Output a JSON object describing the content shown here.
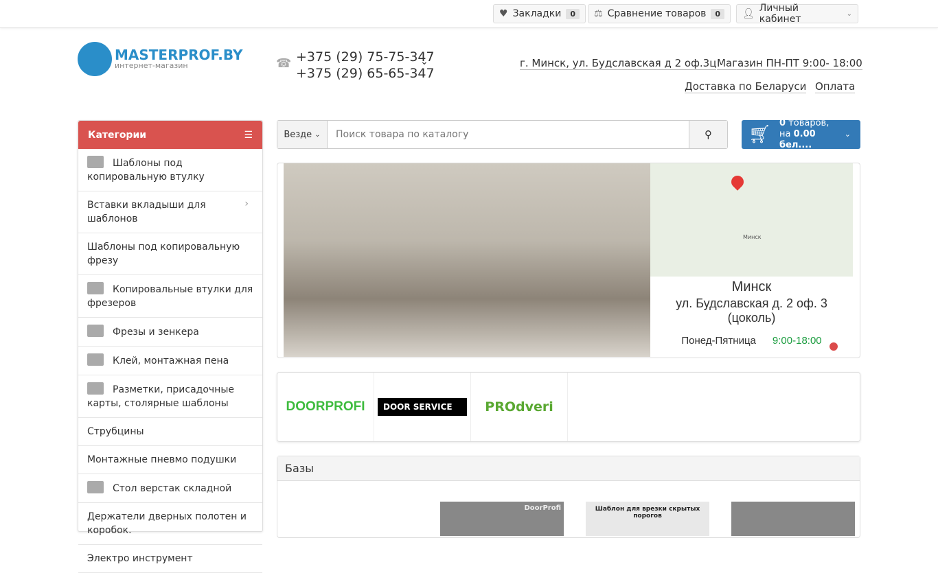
{
  "topbar": {
    "bookmarks": "Закладки",
    "bookmarks_count": "0",
    "compare": "Сравнение товаров",
    "compare_count": "0",
    "account": "Личный кабинет"
  },
  "logo": {
    "name": "MASTERPROF.BY",
    "sub": "интернет-магазин"
  },
  "phones": [
    "+375 (29) 75-75-347",
    "+375 (29) 65-65-347"
  ],
  "header_links": {
    "address": "г. Минск, ул. Будславская д 2 оф.3ц",
    "hours": "Магазин ПН-ПТ 9:00- 18:00",
    "delivery": "Доставка по Беларуси",
    "payment": "Оплата"
  },
  "categories": {
    "title": "Категории",
    "items": [
      {
        "label": "Шаблоны под копировальную втулку",
        "icon": true
      },
      {
        "label": "Вставки вкладыши для шаблонов",
        "icon": false,
        "sub": true
      },
      {
        "label": "Шаблоны под копировальную фрезу",
        "icon": false
      },
      {
        "label": "Копировальные втулки для фрезеров",
        "icon": true
      },
      {
        "label": "Фрезы и зенкера",
        "icon": true
      },
      {
        "label": "Клей, монтажная пена",
        "icon": true
      },
      {
        "label": "Разметки, присадочные карты, столярные шаблоны",
        "icon": true
      },
      {
        "label": "Струбцины",
        "icon": false
      },
      {
        "label": "Монтажные пневмо подушки",
        "icon": false
      },
      {
        "label": "Стол верстак складной",
        "icon": true
      },
      {
        "label": "Держатели дверных полотен и коробок.",
        "icon": false
      },
      {
        "label": "Электро инструмент",
        "icon": false
      }
    ]
  },
  "search": {
    "scope": "Везде",
    "placeholder": "Поиск товара по каталогу"
  },
  "cart": {
    "count": "0",
    "count_label": " товаров,",
    "prefix": "на ",
    "total": "0.00 бел...."
  },
  "slide": {
    "city": "Минск",
    "address": "ул. Будславская д. 2 оф. 3 (цоколь)",
    "days": "Понед-Пятница",
    "hours": "9:00-18:00",
    "map_city": "Минск"
  },
  "brands": [
    "DOORPROFI",
    "DOOR SERVICE",
    "PROdveri"
  ],
  "section": {
    "title": "Базы",
    "thumb_caption": "Шаблон для врезки скрытых порогов",
    "thumb_brand": "DoorProfi"
  },
  "colors": {
    "accent_red": "#d9534f",
    "cart_blue": "#337ab7",
    "hours_green": "#1a9c3e"
  }
}
